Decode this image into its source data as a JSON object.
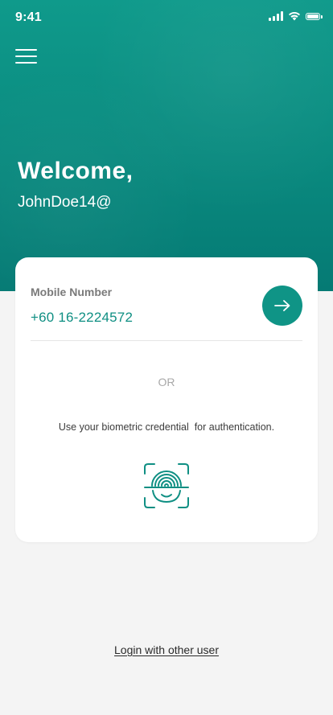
{
  "status_bar": {
    "time": "9:41",
    "icons": [
      "signal-icon",
      "wifi-icon",
      "battery-icon"
    ]
  },
  "header": {
    "menu_icon": "hamburger-menu-icon",
    "welcome": "Welcome,",
    "username": "JohnDoe14@"
  },
  "login_card": {
    "mobile_label": "Mobile Number",
    "mobile_value": "+60 16-2224572",
    "submit_icon": "arrow-right-icon",
    "or_text": "OR",
    "biometric_text": "Use your biometric credential  for authentication.",
    "biometric_icon": "face-fingerprint-scan-icon"
  },
  "footer": {
    "other_user_link": "Login with other user"
  },
  "colors": {
    "brand_teal": "#0f9486",
    "background": "#f4f4f4",
    "card": "#ffffff",
    "label_gray": "#7a7a7a"
  }
}
